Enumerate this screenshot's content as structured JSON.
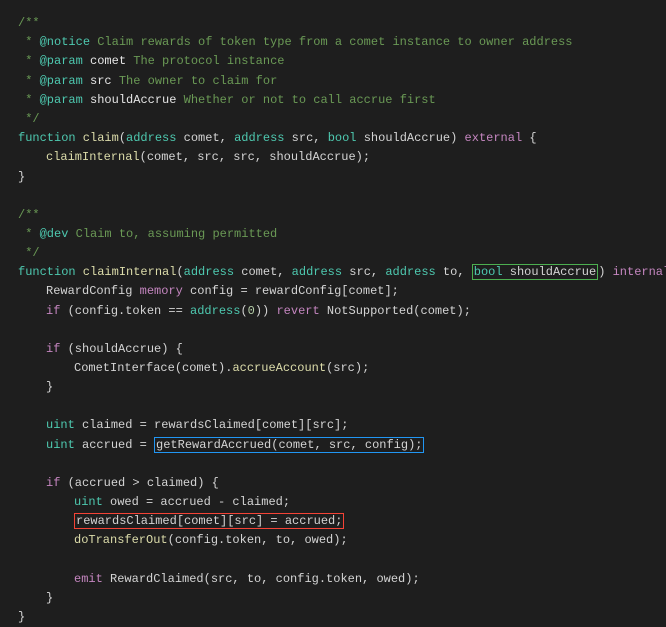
{
  "c1": "/**",
  "c2_star": " * ",
  "c2_tag": "@notice",
  "c2_txt": " Claim rewards of token type from a comet instance to owner address",
  "c3_star": " * ",
  "c3_tag": "@param",
  "c3_name": " comet",
  "c3_txt": " The protocol instance",
  "c4_star": " * ",
  "c4_tag": "@param",
  "c4_name": " src",
  "c4_txt": " The owner to claim for",
  "c5_star": " * ",
  "c5_tag": "@param",
  "c5_name": " shouldAccrue",
  "c5_txt": " Whether or not to call accrue first",
  "c6": " */",
  "fn1_kw": "function",
  "fn1_name": " claim",
  "fn1_p1": "(",
  "fn1_t1": "address",
  "fn1_n1": " comet, ",
  "fn1_t2": "address",
  "fn1_n2": " src, ",
  "fn1_t3": "bool",
  "fn1_n3": " shouldAccrue) ",
  "fn1_ext": "external",
  "fn1_ob": " {",
  "l8_call": "claimInternal",
  "l8_args": "(comet, src, src, shouldAccrue);",
  "l9": "}",
  "c10": "/**",
  "c11_star": " * ",
  "c11_tag": "@dev",
  "c11_txt": " Claim to, assuming permitted",
  "c12": " */",
  "fn2_kw": "function",
  "fn2_name": " claimInternal",
  "fn2_p1": "(",
  "fn2_t1": "address",
  "fn2_n1": " comet, ",
  "fn2_t2": "address",
  "fn2_n2": " src, ",
  "fn2_t3": "address",
  "fn2_n3": " to, ",
  "fn2_t4": "bool",
  "fn2_n4": " shouldAccrue",
  "fn2_p2": ") ",
  "fn2_int": "internal",
  "fn2_ob": " {",
  "l15_a": "RewardConfig ",
  "l15_mem": "memory",
  "l15_b": " config = rewardConfig[comet];",
  "l16_if": "if",
  "l16_a": " (config.token == ",
  "l16_addr": "address",
  "l16_p1": "(",
  "l16_zero": "0",
  "l16_p2": ")) ",
  "l16_rev": "revert",
  "l16_b": " NotSupported(comet);",
  "l18_if": "if",
  "l18_a": " (shouldAccrue) {",
  "l19_a": "CometInterface(comet).",
  "l19_call": "accrueAccount",
  "l19_b": "(src);",
  "l20": "}",
  "l22_t": "uint",
  "l22_a": " claimed = rewardsClaimed[comet][src];",
  "l23_t": "uint",
  "l23_a": " accrued = ",
  "l23_box": "getRewardAccrued(comet, src, config);",
  "l25_if": "if",
  "l25_a": " (accrued > claimed) {",
  "l26_t": "uint",
  "l26_a": " owed = accrued - claimed;",
  "l27_box": "rewardsClaimed[comet][src] = accrued;",
  "l28_call": "doTransferOut",
  "l28_a": "(config.token, to, owed);",
  "l30_emit": "emit",
  "l30_a": " RewardClaimed(src, to, config.token, owed);",
  "l31": "}",
  "l32": "}"
}
